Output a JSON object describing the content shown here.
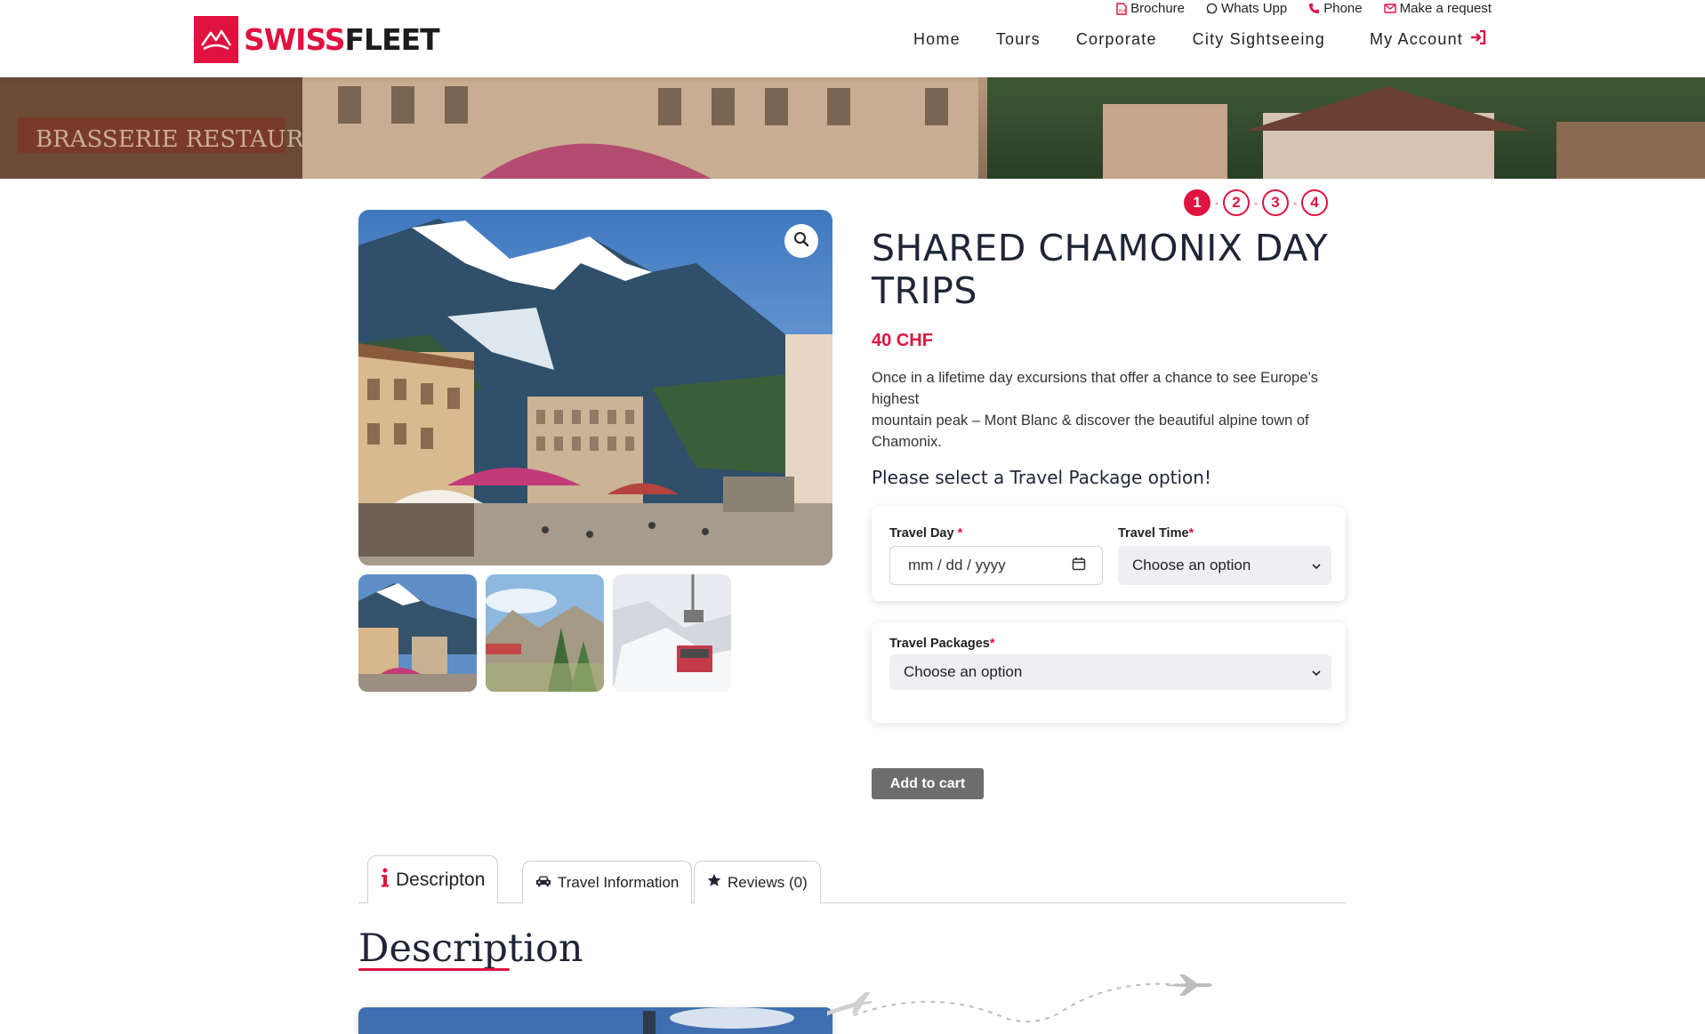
{
  "brand": {
    "swiss": "SWISS",
    "fleet": "FLEET",
    "accent": "#e0123f"
  },
  "top_links": [
    {
      "label": "Brochure",
      "icon": "pdf-icon"
    },
    {
      "label": "Whats Upp",
      "icon": "whatsapp-icon"
    },
    {
      "label": "Phone",
      "icon": "phone-icon"
    },
    {
      "label": "Make a request",
      "icon": "envelope-icon"
    }
  ],
  "nav": {
    "home": "Home",
    "tours": "Tours",
    "corporate": "Corporate",
    "city_sightseeing": "City Sightseeing",
    "my_account": "My Account"
  },
  "steps": [
    "1",
    "2",
    "3",
    "4"
  ],
  "product": {
    "title": "SHARED CHAMONIX DAY TRIPS",
    "price": "40 CHF",
    "description_line1": "Once in a lifetime day excursions that offer a chance to see Europe’s highest",
    "description_line2": "mountain peak – Mont Blanc & discover the beautiful alpine town of Chamonix."
  },
  "form": {
    "heading": "Please select a Travel Package option!",
    "travel_day_label": "Travel Day",
    "travel_day_placeholder": "mm / dd / yyyy",
    "travel_time_label": "Travel Time",
    "travel_time_value": "Choose an option",
    "travel_packages_label": "Travel Packages",
    "travel_packages_value": "Choose an option",
    "required_mark": "*",
    "add_to_cart": "Add to cart"
  },
  "tabs": {
    "description": "Descripton",
    "travel_information": "Travel Information",
    "reviews": "Reviews (0)"
  },
  "section": {
    "heading": "Description"
  }
}
